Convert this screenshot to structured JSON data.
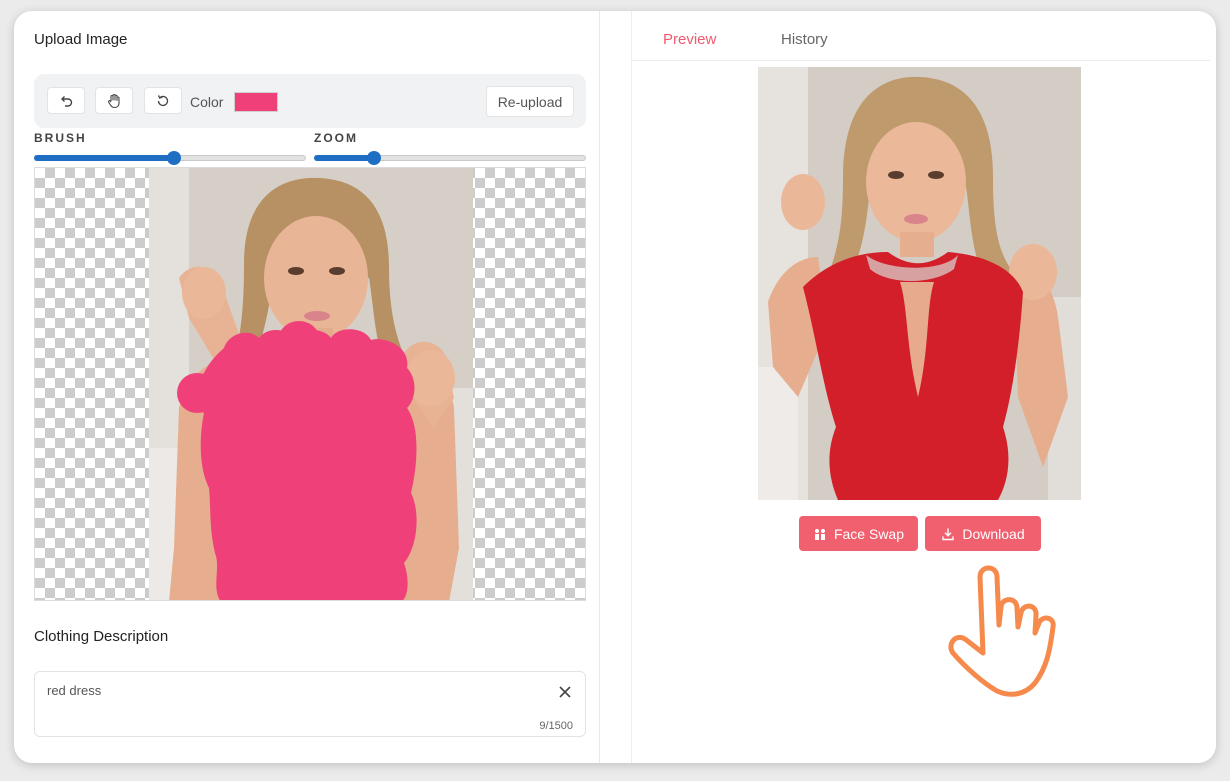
{
  "left_panel": {
    "upload_title": "Upload Image",
    "toolbar": {
      "undo_icon": "undo-icon",
      "hand_icon": "hand-icon",
      "reset_icon": "rotate-icon",
      "color_label": "Color",
      "color_value": "#ef4079",
      "reupload_label": "Re-upload"
    },
    "brush": {
      "label": "BRUSH",
      "value_fraction": 0.51
    },
    "zoom": {
      "label": "ZOOM",
      "value_fraction": 0.22
    },
    "clothing_title": "Clothing Description",
    "description": {
      "value": "red dress",
      "counter": "9/1500"
    }
  },
  "right_panel": {
    "tabs": [
      {
        "label": "Preview",
        "active": true
      },
      {
        "label": "History",
        "active": false
      }
    ],
    "face_swap_label": "Face Swap",
    "download_label": "Download"
  },
  "colors": {
    "accent": "#f0606f",
    "mask": "#ef4079",
    "slider": "#1e6fc4",
    "dress": "#d21f2a",
    "pointer": "#f58a4c"
  }
}
